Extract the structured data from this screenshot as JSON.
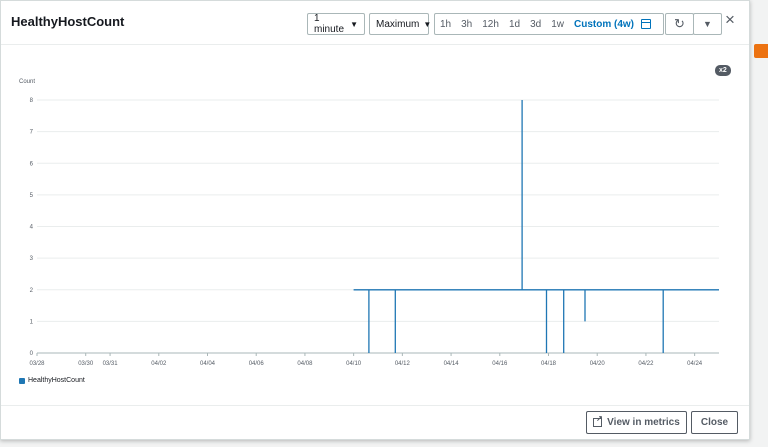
{
  "modal": {
    "title": "HealthyHostCount"
  },
  "toolbar": {
    "period": "1 minute",
    "statistic": "Maximum",
    "ranges": [
      "1h",
      "3h",
      "12h",
      "1d",
      "3d",
      "1w"
    ],
    "custom_range": "Custom (4w)",
    "refresh_icon": "refresh-icon",
    "dropdown_icon": "caret-down-icon",
    "close_icon": "close-icon"
  },
  "badge": "x2",
  "legend": {
    "label": "HealthyHostCount",
    "color": "#1f77b4"
  },
  "footer": {
    "view_in_metrics": "View in metrics",
    "close": "Close"
  },
  "chart_data": {
    "type": "line",
    "ylabel": "Count",
    "ylim": [
      0,
      8
    ],
    "yticks": [
      0,
      1,
      2,
      3,
      4,
      5,
      6,
      7,
      8
    ],
    "xticks": [
      "03/28",
      "03/30",
      "03/31",
      "04/02",
      "04/04",
      "04/06",
      "04/08",
      "04/10",
      "04/12",
      "04/14",
      "04/16",
      "04/18",
      "04/20",
      "04/22",
      "04/24"
    ],
    "grid": true,
    "legend_position": "bottom-left",
    "series": [
      {
        "name": "HealthyHostCount",
        "color": "#1f77b4",
        "points": [
          {
            "x": "04/10 00:00",
            "y": 2
          },
          {
            "x": "04/10 15:00",
            "y": 2
          },
          {
            "x": "04/10 15:00",
            "y": 0
          },
          {
            "x": "04/10 15:00",
            "y": 2
          },
          {
            "x": "04/11 17:00",
            "y": 2
          },
          {
            "x": "04/11 17:00",
            "y": 0
          },
          {
            "x": "04/11 17:00",
            "y": 2
          },
          {
            "x": "04/16 22:00",
            "y": 2
          },
          {
            "x": "04/16 22:00",
            "y": 8
          },
          {
            "x": "04/16 22:00",
            "y": 2
          },
          {
            "x": "04/17 22:00",
            "y": 2
          },
          {
            "x": "04/17 22:00",
            "y": 0
          },
          {
            "x": "04/17 22:00",
            "y": 2
          },
          {
            "x": "04/18 15:00",
            "y": 2
          },
          {
            "x": "04/18 15:00",
            "y": 0
          },
          {
            "x": "04/18 15:00",
            "y": 2
          },
          {
            "x": "04/19 12:00",
            "y": 2
          },
          {
            "x": "04/19 12:00",
            "y": 1
          },
          {
            "x": "04/19 12:00",
            "y": 2
          },
          {
            "x": "04/22 17:00",
            "y": 2
          },
          {
            "x": "04/22 17:00",
            "y": 0
          },
          {
            "x": "04/22 17:00",
            "y": 2
          },
          {
            "x": "04/25 00:00",
            "y": 2
          }
        ]
      }
    ]
  }
}
